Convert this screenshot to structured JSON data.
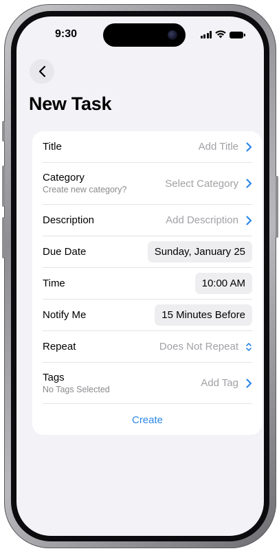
{
  "status_bar": {
    "time": "9:30"
  },
  "nav": {
    "back_icon": "chevron-left-icon"
  },
  "page": {
    "title": "New Task"
  },
  "form": {
    "title": {
      "label": "Title",
      "value": "Add Title"
    },
    "category": {
      "label": "Category",
      "sublabel": "Create new category?",
      "value": "Select Category"
    },
    "description": {
      "label": "Description",
      "value": "Add Description"
    },
    "due_date": {
      "label": "Due Date",
      "value": "Sunday, January 25"
    },
    "time": {
      "label": "Time",
      "value": "10:00 AM"
    },
    "notify": {
      "label": "Notify Me",
      "value": "15 Minutes Before"
    },
    "repeat": {
      "label": "Repeat",
      "value": "Does Not Repeat"
    },
    "tags": {
      "label": "Tags",
      "sublabel": "No Tags Selected",
      "value": "Add Tag"
    },
    "create_label": "Create"
  },
  "colors": {
    "accent": "#2b87e8",
    "background": "#f2f2f7",
    "card": "#ffffff",
    "placeholder": "#a1a1a6"
  }
}
